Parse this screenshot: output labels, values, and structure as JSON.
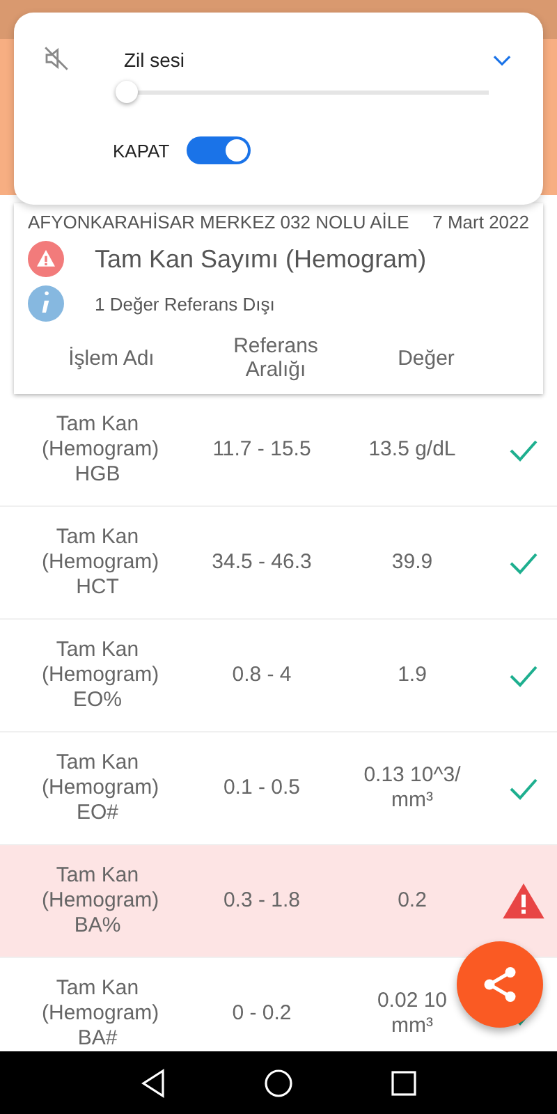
{
  "volume_panel": {
    "label": "Zil sesi",
    "muted": true,
    "level": 0.0,
    "toggle": {
      "label": "KAPAT",
      "on": true
    }
  },
  "card": {
    "institution": "AFYONKARAHİSAR MERKEZ 032 NOLU AİLE",
    "date": "7 Mart 2022",
    "title": "Tam Kan Sayımı (Hemogram)",
    "note": "1 Değer Referans Dışı",
    "columns": [
      "İşlem Adı",
      "Referans Aralığı",
      "Değer"
    ]
  },
  "rows": [
    {
      "name": "Tam Kan (Hemogram) HGB",
      "range": "11.7 - 15.5",
      "value": "13.5 g/dL",
      "flagged": false
    },
    {
      "name": "Tam Kan (Hemogram) HCT",
      "range": "34.5 - 46.3",
      "value": "39.9",
      "flagged": false
    },
    {
      "name": "Tam Kan (Hemogram) EO%",
      "range": "0.8 - 4",
      "value": "1.9",
      "flagged": false
    },
    {
      "name": "Tam Kan (Hemogram) EO#",
      "range": "0.1 - 0.5",
      "value": "0.13 10^3/ mm³",
      "flagged": false
    },
    {
      "name": "Tam Kan (Hemogram) BA%",
      "range": "0.3 - 1.8",
      "value": "0.2",
      "flagged": true
    },
    {
      "name": "Tam Kan (Hemogram) BA#",
      "range": "0 - 0.2",
      "value": "0.02 10 mm³",
      "flagged": false
    }
  ]
}
